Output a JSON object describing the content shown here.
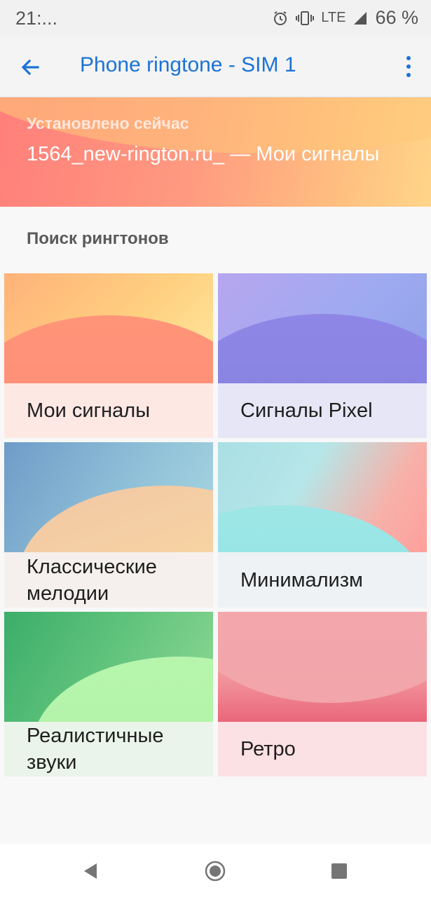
{
  "status_bar": {
    "time": "21:...",
    "network": "LTE",
    "battery_percent": "66 %"
  },
  "app_bar": {
    "title": "Phone ringtone - SIM 1"
  },
  "current_ringtone": {
    "label": "Установлено сейчас",
    "value": "1564_new-rington.ru_ — Мои сигналы"
  },
  "section": {
    "title": "Поиск рингтонов"
  },
  "categories": [
    {
      "label": "Мои сигналы"
    },
    {
      "label": "Сигналы Pixel"
    },
    {
      "label": "Классические мелодии"
    },
    {
      "label": "Минимализм"
    },
    {
      "label": "Реалистичные звуки"
    },
    {
      "label": "Ретро"
    }
  ],
  "navigation": {
    "back": "back-triangle-icon",
    "home": "home-circle-icon",
    "recents": "recents-square-icon"
  }
}
